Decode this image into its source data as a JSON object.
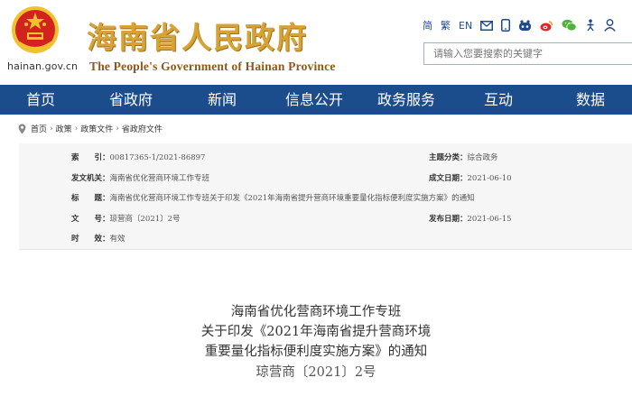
{
  "header": {
    "domain": "hainan.gov.cn",
    "title_cn": "海南省人民政府",
    "title_en": "The People's Government of Hainan Province"
  },
  "tools": {
    "simplified": "简",
    "traditional": "繁",
    "english": "EN",
    "icons": [
      "mail-icon",
      "mobile-icon",
      "accessibility-icon",
      "weibo-icon",
      "wechat-icon",
      "elder-mode-icon",
      "user-icon"
    ]
  },
  "search": {
    "placeholder": "请输入您要搜索的关键字"
  },
  "nav": [
    "首页",
    "省政府",
    "新闻",
    "信息公开",
    "政务服务",
    "互动",
    "数据"
  ],
  "breadcrumb": [
    "首页",
    "政策",
    "政策文件",
    "省政府文件"
  ],
  "info": {
    "index_label": "索　　引：",
    "index_value": "00817365-1/2021-86897",
    "topic_label": "主题分类：",
    "topic_value": "综合政务",
    "issuer_label": "发文机关：",
    "issuer_value": "海南省优化营商环境工作专班",
    "created_label": "成文日期：",
    "created_value": "2021-06-10",
    "title_label": "标　　题：",
    "title_value": "海南省优化营商环境工作专班关于印发《2021年海南省提升营商环境重要量化指标便利度实施方案》的通知",
    "docno_label": "文　　号：",
    "docno_value": "琼营商〔2021〕2号",
    "published_label": "发布日期：",
    "published_value": "2021-06-15",
    "validity_label": "时　　效：",
    "validity_value": "有效"
  },
  "document": {
    "line1": "海南省优化营商环境工作专班",
    "line2": "关于印发《2021年海南省提升营商环境",
    "line3": "重要量化指标便利度实施方案》的通知",
    "doc_number": "琼营商〔2021〕2号"
  },
  "colors": {
    "nav_bg": "#1b4c8c",
    "title_gold": "#d7a236",
    "emblem_red": "#d2231e",
    "emblem_gold": "#f2c12e",
    "link_blue": "#1e4a8f"
  }
}
